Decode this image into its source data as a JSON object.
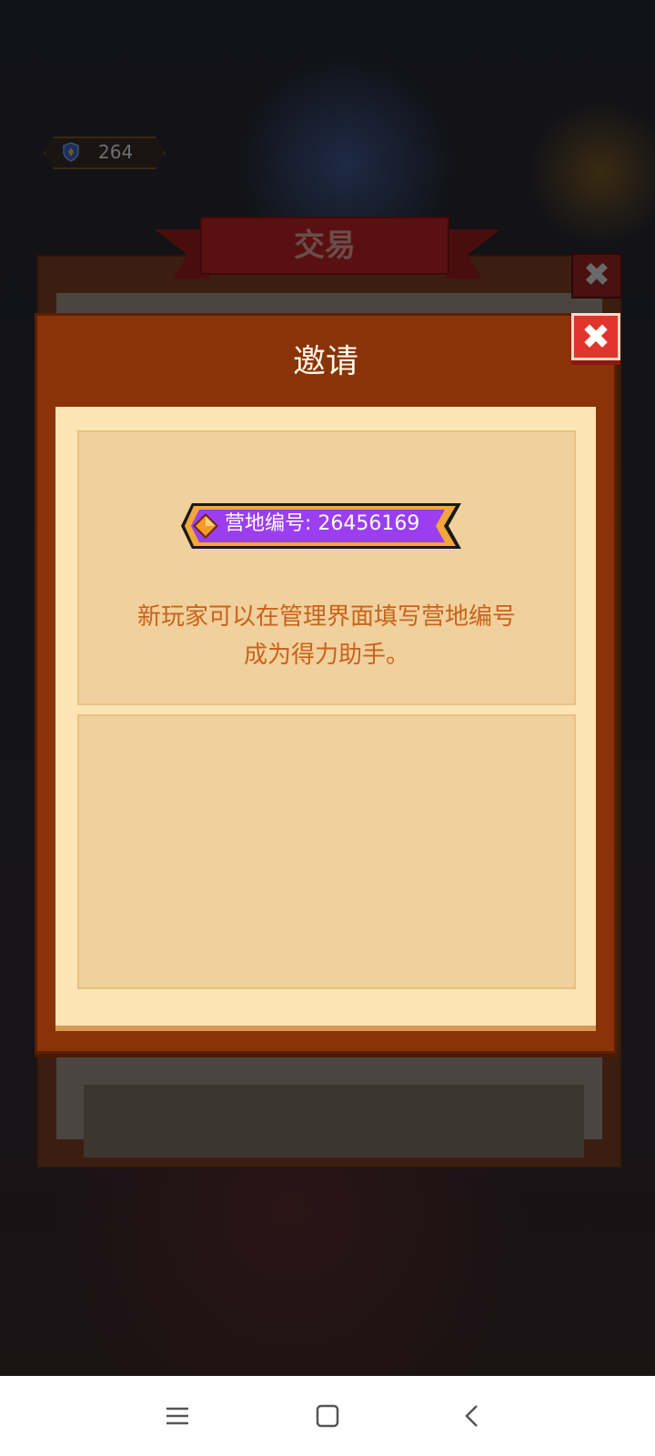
{
  "background": {
    "coin_counter": {
      "value": "264",
      "icon": "shield-icon"
    },
    "trade_panel": {
      "title": "交易",
      "close_icon": "close-icon"
    }
  },
  "dialog": {
    "title": "邀请",
    "close_icon": "close-icon",
    "camp_id_label": "营地编号: 26456169",
    "hint_line1": "新玩家可以在管理界面填写营地编号",
    "hint_line2": "成为得力助手。"
  },
  "nav_bar": {
    "menu_icon": "menu-icon",
    "home_icon": "home-icon",
    "back_icon": "back-icon"
  },
  "colors": {
    "dialog_frame": "#8a3308",
    "dialog_inner": "#fde4b4",
    "panel_box": "#f0d09c",
    "hint_text": "#c9631b",
    "badge_purple": "#9b3ef0",
    "badge_border": "#f0a838",
    "close_red": "#e0342c"
  }
}
